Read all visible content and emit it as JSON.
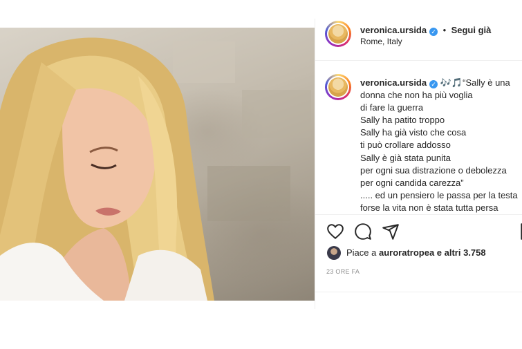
{
  "post": {
    "username": "veronica.ursida",
    "follow_label": "Segui già",
    "separator": "•",
    "location": "Rome, Italy"
  },
  "caption": {
    "username": "veronica.ursida",
    "emoji": "🎶🎵",
    "lines": [
      "“Sally è una",
      "donna che non ha più voglia",
      "di fare la guerra",
      "Sally ha patito troppo",
      "Sally ha già visto che cosa",
      "ti può crollare addosso",
      "Sally è già stata punita",
      "per ogni sua distrazione o debolezza",
      "per ogni candida carezza”",
      "..... ed un pensiero le passa per la testa",
      "forse la vita non è stata tutta persa"
    ]
  },
  "likes": {
    "prefix": "Piace a ",
    "user": "auroratropea",
    "suffix": " e altri 3.758"
  },
  "timestamp": "23 ORE FA",
  "icons": [
    "heart-icon",
    "comment-icon",
    "share-icon",
    "bookmark-icon"
  ],
  "colors": {
    "verified": "#3897f0",
    "border": "#efefef",
    "muted": "#8e8e8e"
  }
}
